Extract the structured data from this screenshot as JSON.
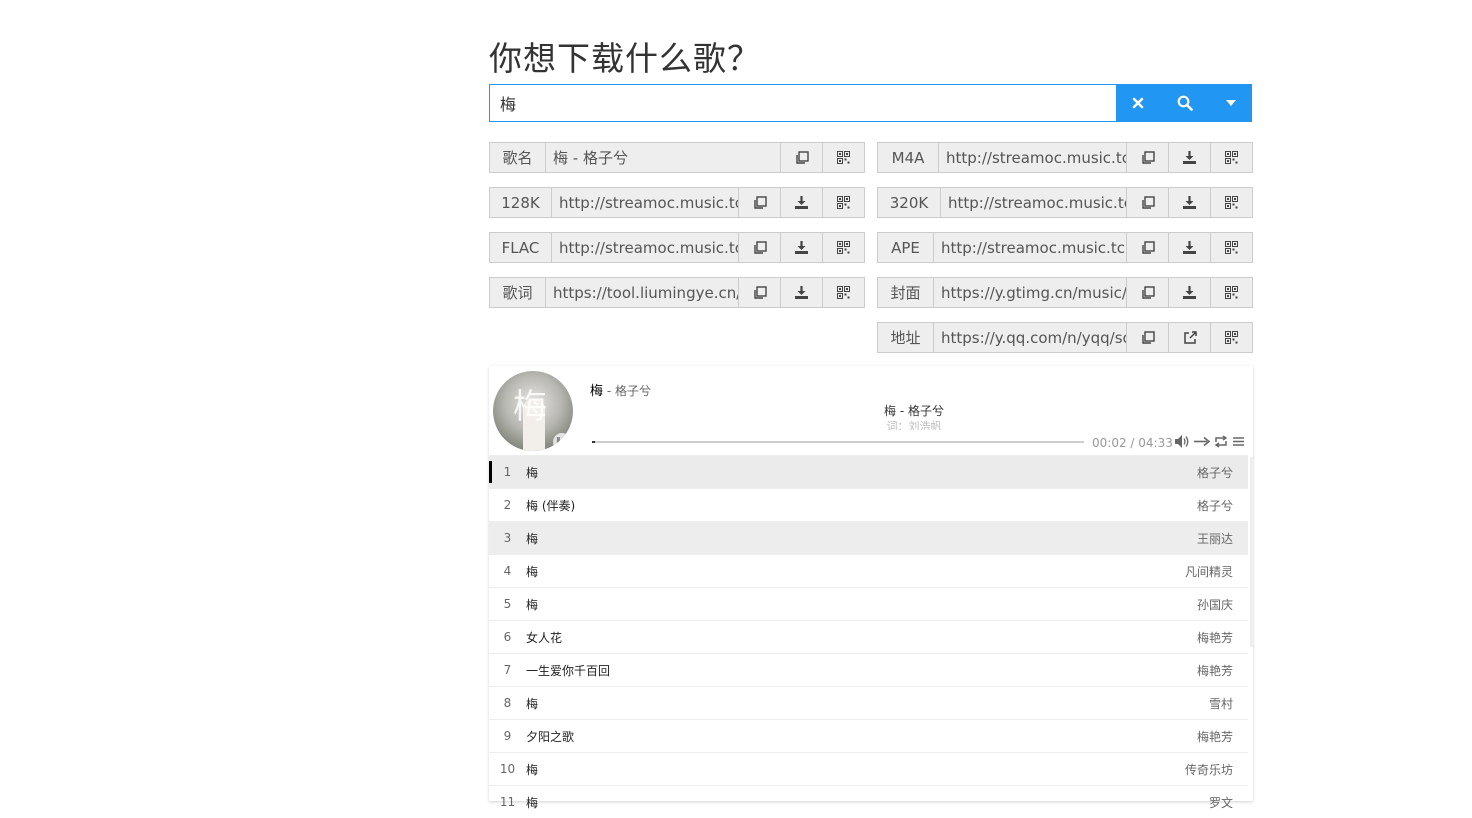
{
  "heading": "你想下载什么歌？",
  "search": {
    "value": "梅"
  },
  "fields": {
    "name": {
      "label": "歌名",
      "value": "梅 - 格子兮"
    },
    "m4a": {
      "label": "M4A",
      "value": "http://streamoc.music.tc.qq.com/"
    },
    "k128": {
      "label": "128K",
      "value": "http://streamoc.music.tc.qq.com/"
    },
    "k320": {
      "label": "320K",
      "value": "http://streamoc.music.tc.qq.com/"
    },
    "flac": {
      "label": "FLAC",
      "value": "http://streamoc.music.tc.qq.com/"
    },
    "ape": {
      "label": "APE",
      "value": "http://streamoc.music.tc.qq.com/"
    },
    "lyric": {
      "label": "歌词",
      "value": "https://tool.liumingye.cn/q"
    },
    "cover": {
      "label": "封面",
      "value": "https://y.gtimg.cn/music/p"
    },
    "url": {
      "label": "地址",
      "value": "https://y.qq.com/n/yqq/so"
    }
  },
  "player": {
    "title": "梅",
    "artist": " - 格子兮",
    "lyric_current": "梅 - 格子兮",
    "lyric_next": "词：刘浩帆",
    "time": "00:02 / 04:33",
    "progress": 0.007
  },
  "playlist": [
    {
      "num": "1",
      "name": "梅",
      "artist": "格子兮"
    },
    {
      "num": "2",
      "name": "梅 (伴奏)",
      "artist": "格子兮"
    },
    {
      "num": "3",
      "name": "梅",
      "artist": "王丽达"
    },
    {
      "num": "4",
      "name": "梅",
      "artist": "凡间精灵"
    },
    {
      "num": "5",
      "name": "梅",
      "artist": "孙国庆"
    },
    {
      "num": "6",
      "name": "女人花",
      "artist": "梅艳芳"
    },
    {
      "num": "7",
      "name": "一生爱你千百回",
      "artist": "梅艳芳"
    },
    {
      "num": "8",
      "name": "梅",
      "artist": "雪村"
    },
    {
      "num": "9",
      "name": "夕阳之歌",
      "artist": "梅艳芳"
    },
    {
      "num": "10",
      "name": "梅",
      "artist": "传奇乐坊"
    },
    {
      "num": "11",
      "name": "梅",
      "artist": "罗文"
    }
  ]
}
